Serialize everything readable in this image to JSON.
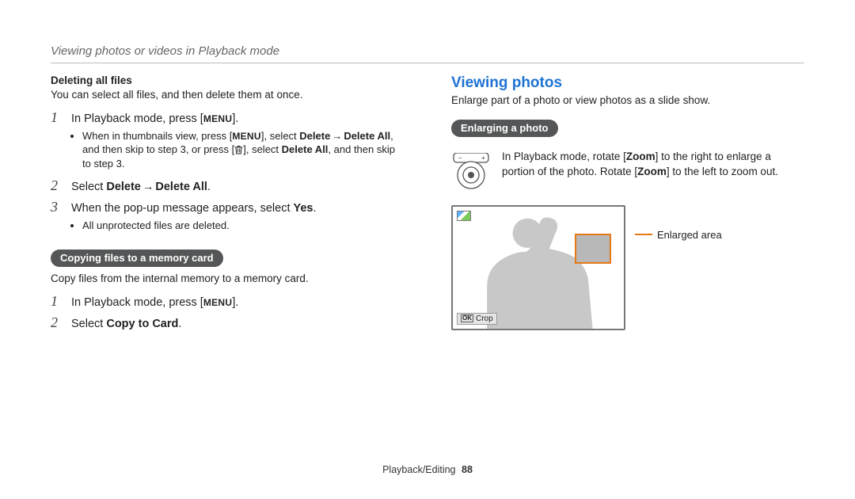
{
  "header": "Viewing photos or videos in Playback mode",
  "left": {
    "delete_heading": "Deleting all files",
    "delete_intro": "You can select all files, and then delete them at once.",
    "menu_label": "MENU",
    "steps1": {
      "s1": {
        "num": "1",
        "pre": "In Playback mode, press [",
        "post": "]."
      },
      "s1_bullets": {
        "b1_a": "When in thumbnails view, press [",
        "b1_b": "], select ",
        "b1_c": "Delete",
        "b1_d": "Delete All",
        "b1_e": ", and then skip to step 3, or press [",
        "b1_f": "], select ",
        "b1_g": "Delete All",
        "b1_h": ", and then skip to step 3."
      },
      "s2": {
        "num": "2",
        "pre": "Select ",
        "b1": "Delete",
        "b2": "Delete All",
        "post": "."
      },
      "s3": {
        "num": "3",
        "pre": "When the pop-up message appears, select ",
        "b": "Yes",
        "post": "."
      },
      "s3_bullet": "All unprotected files are deleted."
    },
    "pill_copy": "Copying files to a memory card",
    "copy_intro": "Copy files from the internal memory to a memory card.",
    "steps2": {
      "s1": {
        "num": "1",
        "pre": "In Playback mode, press [",
        "post": "]."
      },
      "s2": {
        "num": "2",
        "pre": "Select ",
        "b": "Copy to Card",
        "post": "."
      }
    }
  },
  "right": {
    "title": "Viewing photos",
    "intro": "Enlarge part of a photo or view photos as a slide show.",
    "pill_enlarge": "Enlarging a photo",
    "zoom_desc_a": "In Playback mode, rotate [",
    "zoom_lbl": "Zoom",
    "zoom_desc_b": "] to the right to enlarge a portion of the photo. Rotate [",
    "zoom_desc_c": "] to the left to zoom out.",
    "callout": "Enlarged area",
    "crop_ok": "OK",
    "crop_label": "Crop"
  },
  "footer": {
    "section": "Playback/Editing",
    "page": "88"
  }
}
